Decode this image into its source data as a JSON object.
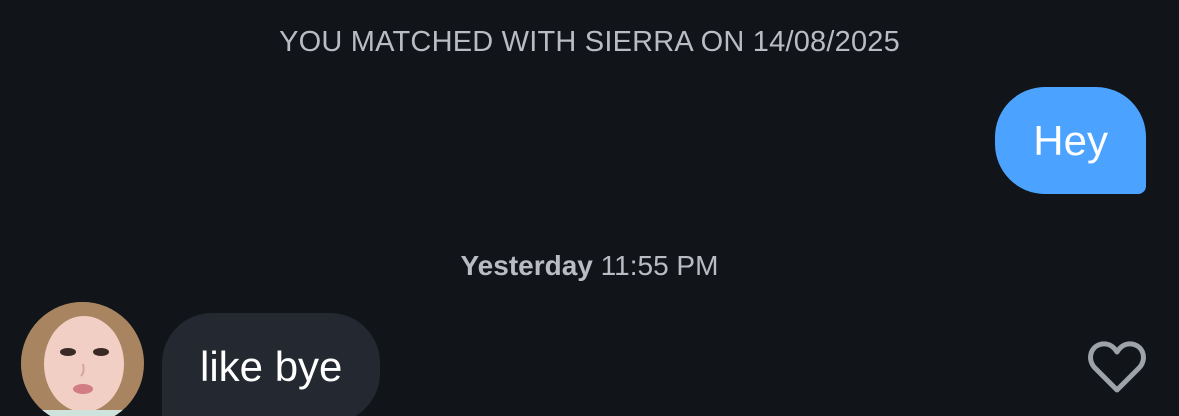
{
  "conversation": {
    "match_header": "YOU MATCHED WITH SIERRA ON 14/08/2025",
    "messages": [
      {
        "direction": "outgoing",
        "text": "Hey"
      },
      {
        "direction": "incoming",
        "text": "like bye"
      }
    ],
    "timestamp": {
      "day": "Yesterday",
      "time": "11:55 PM"
    }
  },
  "icons": {
    "avatar": "profile-photo",
    "like": "heart-outline-icon"
  },
  "colors": {
    "background": "#111418",
    "outgoing_bubble": "#4ba3ff",
    "incoming_bubble": "#242830",
    "meta_text": "#b9bcc3"
  }
}
